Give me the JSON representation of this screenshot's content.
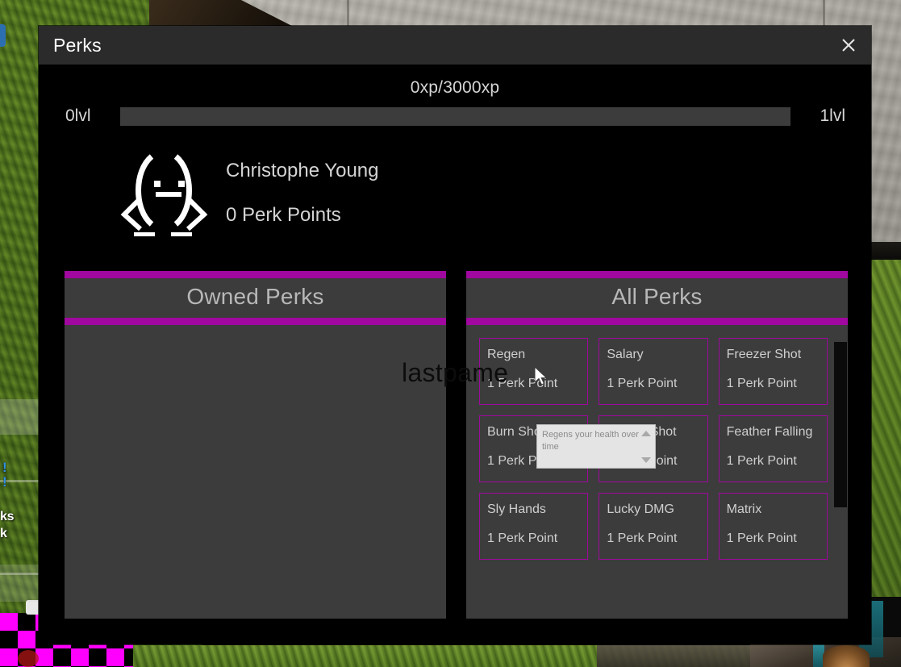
{
  "window": {
    "title": "Perks",
    "close_icon": "close-icon"
  },
  "xp": {
    "text": "0xp/3000xp",
    "current_level_label": "0lvl",
    "next_level_label": "1lvl",
    "progress_percent": 0,
    "bar_track_color": "#3c3c3c"
  },
  "character": {
    "avatar_icon": "ascii-face-avatar",
    "name": "Christophe Young",
    "perk_points": "0 Perk Points"
  },
  "panels": {
    "owned": {
      "title": "Owned Perks",
      "perks": []
    },
    "all": {
      "title": "All Perks",
      "perks": [
        {
          "name": "Regen",
          "cost": "1 Perk Point"
        },
        {
          "name": "Salary",
          "cost": "1 Perk Point"
        },
        {
          "name": "Freezer Shot",
          "cost": "1 Perk Point"
        },
        {
          "name": "Burn Shot",
          "cost": "1 Perk Point"
        },
        {
          "name": "Poison Shot",
          "cost": "1 Perk Point"
        },
        {
          "name": "Feather Falling",
          "cost": "1 Perk Point"
        },
        {
          "name": "Sly Hands",
          "cost": "1 Perk Point"
        },
        {
          "name": "Lucky DMG",
          "cost": "1 Perk Point"
        },
        {
          "name": "Matrix",
          "cost": "1 Perk Point"
        }
      ]
    },
    "accent_color": "#a0089f",
    "panel_background": "#3c3c3c"
  },
  "tooltip": {
    "text": "Regens your health over time",
    "scroll_up_icon": "triangle-up-icon",
    "scroll_down_icon": "triangle-down-icon"
  },
  "world_overlay": {
    "text": "lastpame"
  },
  "hud": {
    "alert_1": "!",
    "alert_2": "!",
    "word_1": "ks",
    "word_2": "k"
  }
}
